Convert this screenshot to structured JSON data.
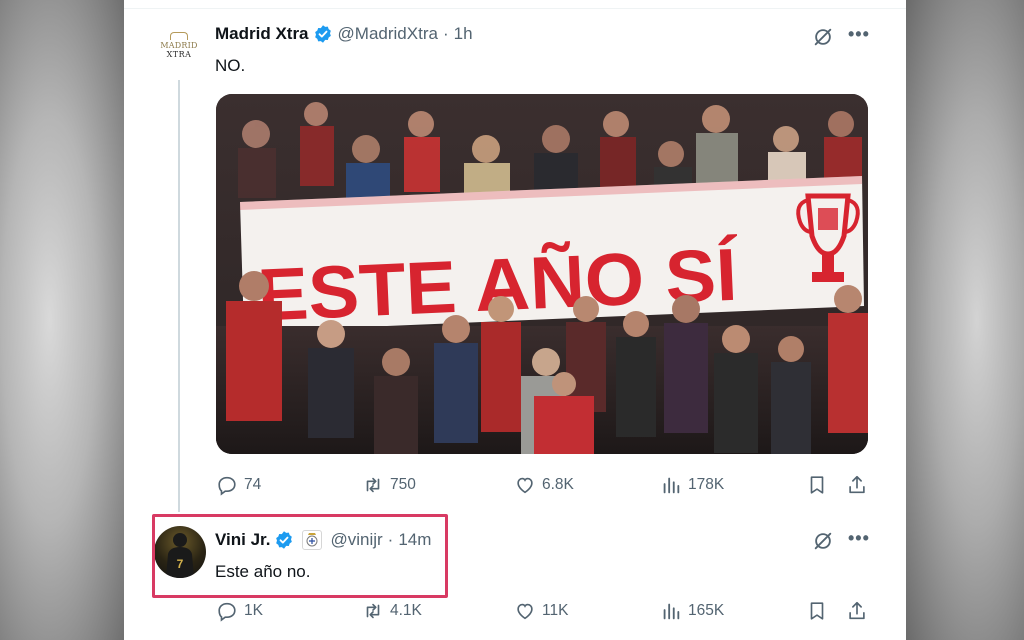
{
  "tweets": [
    {
      "author": "Madrid Xtra",
      "handle": "@MadridXtra",
      "time": "1h",
      "text": "NO.",
      "avatar_text_line1": "MADRID",
      "avatar_text_line2": "XTRA",
      "image": {
        "banner_text": "ESTE AÑO SÍ",
        "banner_color": "#d7242f",
        "crowd_color": "#2a2323"
      },
      "stats": {
        "replies": "74",
        "reposts": "750",
        "likes": "6.8K",
        "views": "178K"
      }
    },
    {
      "author": "Vini Jr.",
      "handle": "@vinijr",
      "time": "14m",
      "text": "Este año no.",
      "stats": {
        "replies": "1K",
        "reposts": "4.1K",
        "likes": "11K",
        "views": "165K"
      }
    }
  ],
  "colors": {
    "verified_blue": "#1d9bf0",
    "highlight_border": "#d83a63",
    "icon_gray": "#536471"
  },
  "separator": "·",
  "more_label": "•••"
}
